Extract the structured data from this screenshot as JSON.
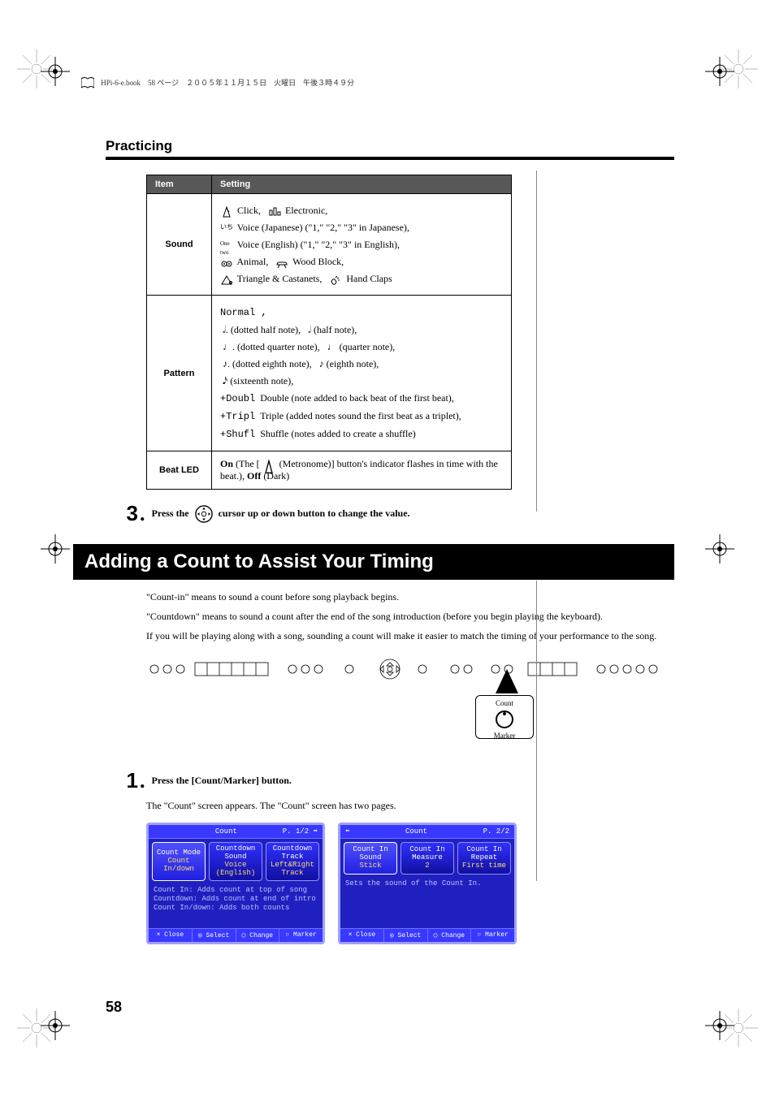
{
  "header": {
    "print_meta": "HPi-6-e.book　58 ページ　２００５年１１月１５日　火曜日　午後３時４９分"
  },
  "section_title": "Practicing",
  "table": {
    "col_item": "Item",
    "col_setting": "Setting",
    "rows": {
      "sound": {
        "label": "Sound",
        "click": "Click,",
        "electronic": "Electronic,",
        "voice_jp": "Voice (Japanese) (\"1,\" \"2,\" \"3\" in Japanese),",
        "voice_en": "Voice (English) (\"1,\" \"2,\" \"3\" in English),",
        "animal": "Animal,",
        "wood": "Wood Block,",
        "triangle": "Triangle & Castanets,",
        "claps": "Hand Claps"
      },
      "pattern": {
        "label": "Pattern",
        "normal": "Normal ,",
        "dhalf": "(dotted half note),",
        "half": "(half note),",
        "dquarter": "(dotted quarter note),",
        "quarter": "(quarter note),",
        "deighth": "(dotted eighth note),",
        "eighth": "(eighth note),",
        "sixteenth": "(sixteenth note),",
        "doubl_label": "+Doubl",
        "doubl": "Double (note added to back beat of the first beat),",
        "tripl_label": "+Tripl",
        "tripl": "Triple (added notes sound the first beat as a triplet),",
        "shufl_label": "+Shufl",
        "shufl": "Shuffle (notes added to create a shuffle)"
      },
      "beatled": {
        "label": "Beat LED",
        "text_on": "On",
        "text_body": " (The [ ",
        "text_body2": " (Metronome)] button's indicator flashes in time with the beat.), ",
        "text_off": "Off",
        "text_dark": " (Dark)"
      }
    }
  },
  "step3": {
    "num": "3",
    "dot": ".",
    "text_a": "Press the ",
    "text_b": " cursor up or down button to change the value."
  },
  "heading": "Adding a Count to Assist Your Timing",
  "intro": {
    "p1": "\"Count-in\" means to sound a count before song playback begins.",
    "p2": "\"Countdown\" means to sound a count after the end of the song introduction (before you begin playing the keyboard).",
    "p3": "If you will be playing along with a song, sounding a count will make it easier to match the timing of your performance to the song."
  },
  "callout": {
    "top": "Count",
    "bottom": "Marker"
  },
  "step1": {
    "num": "1",
    "dot": ".",
    "text": "Press the [Count/Marker] button.",
    "sub": "The \"Count\" screen appears. The \"Count\" screen has two pages."
  },
  "lcd1": {
    "title": "Count",
    "page": "P. 1/2 ➡",
    "tile1a": "Count Mode",
    "tile1b": "Count In/down",
    "tile2a": "Countdown Sound",
    "tile2b": "Voice (English)",
    "tile3a": "Countdown Track",
    "tile3b": "Left&Right Track",
    "cap1": "Count In: Adds count at top of song",
    "cap2": "Countdown: Adds count at end of intro",
    "cap3": "Count In/down: Adds both counts",
    "f1": "× Close",
    "f2": "◎ Select",
    "f3": "◯ Change",
    "f4": "○ Marker"
  },
  "lcd2": {
    "title": "Count",
    "page": "P. 2/2",
    "back": "⬅",
    "tile1a": "Count In Sound",
    "tile1b": "Stick",
    "tile2a": "Count In Measure",
    "tile2b": "2",
    "tile3a": "Count In Repeat",
    "tile3b": "First time",
    "cap1": "Sets the sound of the Count In.",
    "f1": "× Close",
    "f2": "◎ Select",
    "f3": "◯ Change",
    "f4": "○ Marker"
  },
  "page_number": "58"
}
